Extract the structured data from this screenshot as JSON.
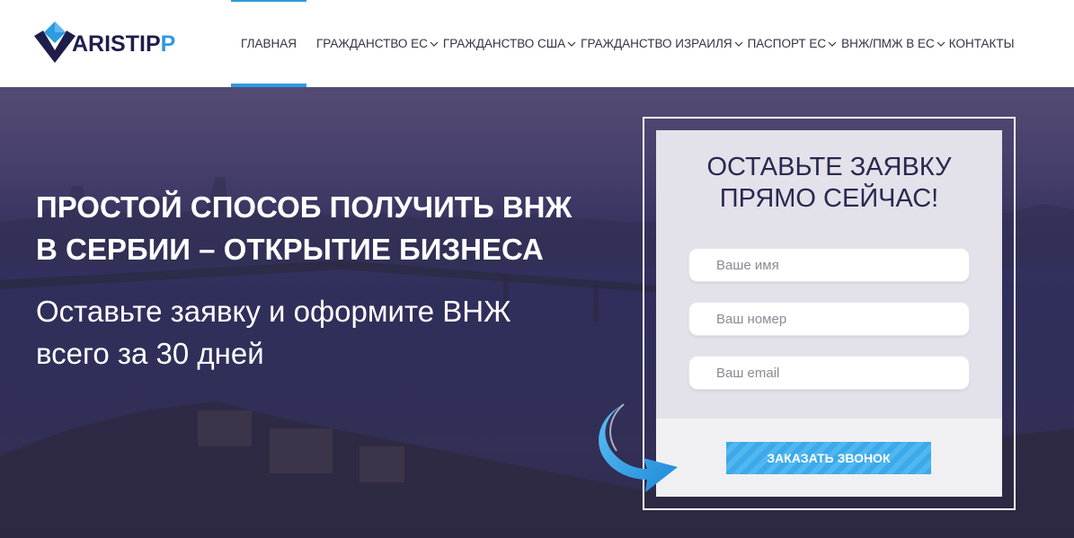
{
  "brand": {
    "name_main": "ARISTIP",
    "name_accent": "P",
    "colors": {
      "navy": "#1f1d4a",
      "accent": "#2d9be0"
    }
  },
  "nav": {
    "items": [
      {
        "label": "ГЛАВНАЯ",
        "dropdown": false,
        "active": true
      },
      {
        "label": "ГРАЖДАНСТВО ЕС",
        "dropdown": true,
        "active": false
      },
      {
        "label": "ГРАЖДАНСТВО США",
        "dropdown": true,
        "active": false
      },
      {
        "label": "ГРАЖДАНСТВО ИЗРАИЛЯ",
        "dropdown": true,
        "active": false
      },
      {
        "label": "ПАСПОРТ ЕС",
        "dropdown": true,
        "active": false
      },
      {
        "label": "ВНЖ/ПМЖ В ЕС",
        "dropdown": true,
        "active": false
      },
      {
        "label": "КОНТАКТЫ",
        "dropdown": false,
        "active": false
      }
    ]
  },
  "hero": {
    "title_line1": "ПРОСТОЙ СПОСОБ ПОЛУЧИТЬ ВНЖ",
    "title_line2": "В СЕРБИИ – ОТКРЫТИЕ БИЗНЕСА",
    "subtitle_line1": "Оставьте заявку и оформите ВНЖ",
    "subtitle_line2": "всего за 30 дней"
  },
  "form": {
    "title_line1": "ОСТАВЬТЕ ЗАЯВКУ",
    "title_line2": "ПРЯМО СЕЙЧАС!",
    "name_placeholder": "Ваше имя",
    "phone_placeholder": "Ваш номер",
    "email_placeholder": "Ваш email",
    "submit_label": "ЗАКАЗАТЬ ЗВОНОК"
  },
  "icons": {
    "logo": "diamond-logo-icon",
    "chevron": "chevron-down-icon",
    "pointer_arrow": "curved-arrow-icon"
  }
}
